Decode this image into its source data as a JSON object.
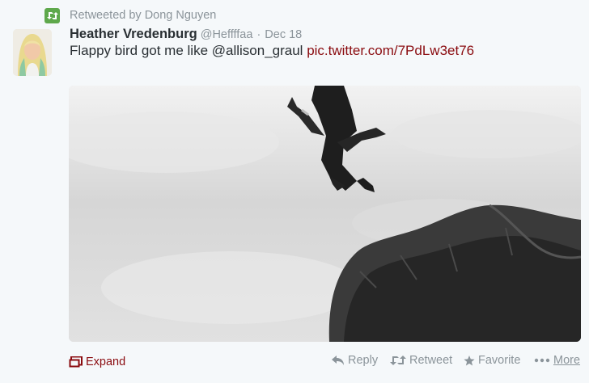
{
  "retweet": {
    "icon": "retweet-icon",
    "text": "Retweeted by Dong Nguyen",
    "color": "#5ea84b"
  },
  "author": {
    "name": "Heather Vredenburg",
    "handle": "@Heffffaa",
    "separator": "·",
    "time": "Dec 18"
  },
  "tweet": {
    "text": "Flappy bird got me like @allison_graul ",
    "link": "pic.twitter.com/7PdLw3et76",
    "link_color": "#8a0b0f"
  },
  "media": {
    "description_icon": "photo"
  },
  "footer": {
    "expand_label": "Expand",
    "actions": {
      "reply": "Reply",
      "retweet": "Retweet",
      "favorite": "Favorite",
      "more": "More"
    }
  }
}
